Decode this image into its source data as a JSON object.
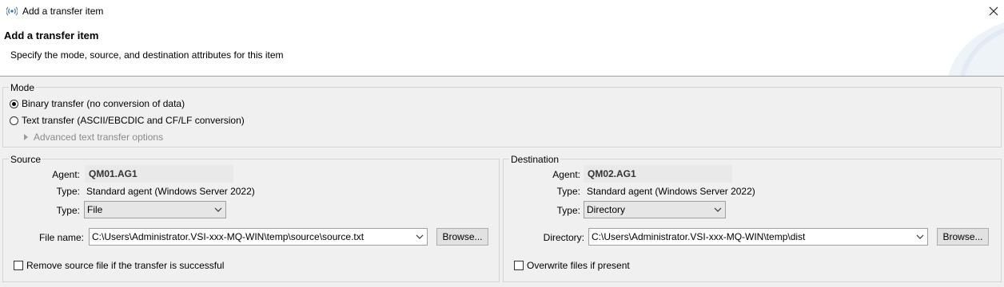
{
  "window": {
    "title": "Add a transfer item",
    "app_icon": "transfer-wizard-icon",
    "close_icon": "close-icon"
  },
  "banner": {
    "heading": "Add a transfer item",
    "subtitle": "Specify the mode, source, and destination attributes for this item"
  },
  "mode": {
    "legend": "Mode",
    "options": [
      {
        "label": "Binary transfer (no conversion of data)",
        "checked": true
      },
      {
        "label": "Text transfer (ASCII/EBCDIC and CF/LF conversion)",
        "checked": false
      }
    ],
    "advanced_label": "Advanced text transfer options"
  },
  "source": {
    "legend": "Source",
    "agent_label": "Agent:",
    "agent_value": "QM01.AG1",
    "type_label": "Type:",
    "agent_type": "Standard agent (Windows Server 2022)",
    "type_select_label": "Type:",
    "type_select_value": "File",
    "file_label": "File name:",
    "file_value": "C:\\Users\\Administrator.VSI-xxx-MQ-WIN\\temp\\source\\source.txt",
    "browse_label": "Browse...",
    "remove_label": "Remove source file if the transfer is successful",
    "remove_checked": false
  },
  "destination": {
    "legend": "Destination",
    "agent_label": "Agent:",
    "agent_value": "QM02.AG1",
    "type_label": "Type:",
    "agent_type": "Standard agent (Windows Server 2022)",
    "type_select_label": "Type:",
    "type_select_value": "Directory",
    "dir_label": "Directory:",
    "dir_value": "C:\\Users\\Administrator.VSI-xxx-MQ-WIN\\temp\\dist",
    "browse_label": "Browse...",
    "overwrite_label": "Overwrite files if present",
    "overwrite_checked": false
  }
}
